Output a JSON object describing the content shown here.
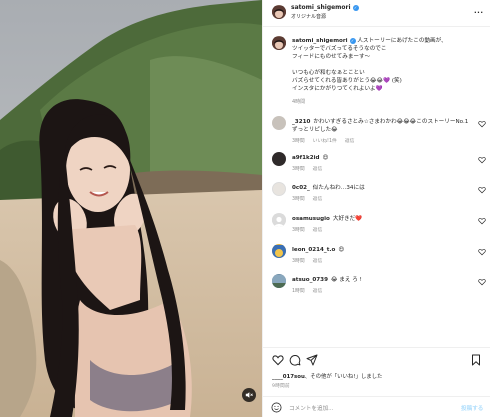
{
  "header": {
    "username": "satomi_shigemori",
    "location": "オリジナル音源",
    "more": "..."
  },
  "caption": {
    "username": "satomi_shigemori",
    "lines": [
      "人ストーリーにあげたこの動画が、",
      "ツイッターでバズってるそうなのでこ",
      "フィードにものせてみまーす〜",
      "",
      "いつも心が和むなぁとことい",
      "バズらせてくれる皆ありがとう😂😂💜 (笑)",
      "インスタにかがりつてくれよいよ💜"
    ],
    "time": "4時間"
  },
  "comments": [
    {
      "user": "_3210",
      "text": "かわいすぎるさとみ☆さまわかわ😂😂😂このストーリーNo.1ずっとリピした😂",
      "time": "3時間",
      "likes": "いいね!1件",
      "reply": "返信"
    },
    {
      "user": "a9f1k2id",
      "text": "😍",
      "time": "3時間",
      "likes": "",
      "reply": "返信"
    },
    {
      "user": "0c02_",
      "text": "似たんねわ…34には",
      "time": "3時間",
      "likes": "",
      "reply": "返信"
    },
    {
      "user": "osamusugio",
      "text": "大好きだ❤️",
      "time": "3時間",
      "likes": "",
      "reply": "返信"
    },
    {
      "user": "leon_0214_t.o",
      "text": "😍",
      "time": "3時間",
      "likes": "",
      "reply": "返信"
    },
    {
      "user": "atsuo_0739",
      "text": "😂 まえ ろ !",
      "time": "1時間",
      "likes": "",
      "reply": "返信"
    }
  ],
  "likes": {
    "user": "____017sou",
    "text": "、その他が「いいね!」しました"
  },
  "date": "9時間前",
  "add_comment": {
    "placeholder": "コメントを追加...",
    "post_label": "投稿する"
  },
  "icons": [
    "mute-icon",
    "more-icon",
    "verified-icon",
    "heart-icon",
    "comment-icon",
    "share-icon",
    "bookmark-icon",
    "emoji-icon"
  ]
}
